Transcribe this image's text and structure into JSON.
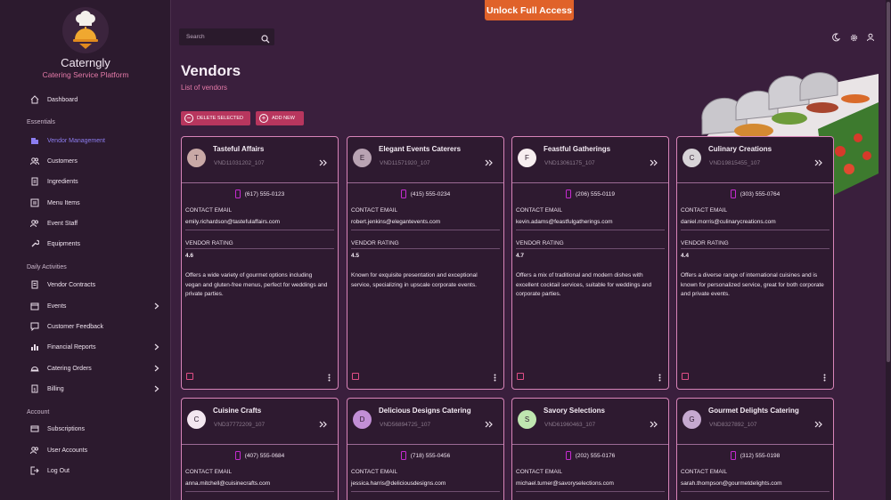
{
  "brand": {
    "name": "Caterngly",
    "tagline": "Catering Service Platform"
  },
  "sidebar": {
    "items": [
      {
        "label": "Dashboard",
        "icon": "home-icon"
      },
      {
        "section": "Essentials"
      },
      {
        "label": "Vendor Management",
        "icon": "building-icon",
        "active": true
      },
      {
        "label": "Customers",
        "icon": "users-icon"
      },
      {
        "label": "Ingredients",
        "icon": "clipboard-icon"
      },
      {
        "label": "Menu Items",
        "icon": "menu-icon"
      },
      {
        "label": "Event Staff",
        "icon": "users-icon"
      },
      {
        "label": "Equipments",
        "icon": "wrench-icon"
      },
      {
        "section": "Daily Activities"
      },
      {
        "label": "Vendor Contracts",
        "icon": "document-icon"
      },
      {
        "label": "Events",
        "icon": "calendar-icon",
        "expandable": true
      },
      {
        "label": "Customer Feedback",
        "icon": "feedback-icon"
      },
      {
        "label": "Financial Reports",
        "icon": "bar-chart-icon",
        "expandable": true
      },
      {
        "label": "Catering Orders",
        "icon": "cloche-icon",
        "expandable": true
      },
      {
        "label": "Billing",
        "icon": "invoice-icon",
        "expandable": true
      },
      {
        "section": "Account"
      },
      {
        "label": "Subscriptions",
        "icon": "subscription-icon"
      },
      {
        "label": "User Accounts",
        "icon": "users-icon"
      },
      {
        "label": "Log Out",
        "icon": "logout-icon"
      }
    ]
  },
  "header": {
    "search_placeholder": "Search",
    "unlock_label": "Unlock Full Access",
    "icons": [
      "moon-icon",
      "gear-icon",
      "user-icon"
    ]
  },
  "page": {
    "title": "Vendors",
    "subtitle": "List of vendors",
    "delete_label": "DELETE SELECTED",
    "add_label": "ADD NEW"
  },
  "labels": {
    "contact_email": "CONTACT EMAIL",
    "vendor_rating": "VENDOR RATING"
  },
  "colors": {
    "accent": "#e47aa8",
    "button": "#b8365e",
    "unlock": "#e0622a",
    "card_border": "#d784b8",
    "active_nav": "#8c7df0",
    "phone_icon": "#c52bd0"
  },
  "vendors": [
    {
      "initial": "T",
      "avatar_color": "#c9a9a6",
      "name": "Tasteful Affairs",
      "code": "VND11031202_107",
      "phone": "(617) 555-0123",
      "email": "emily.richardson@tastefulaffairs.com",
      "rating": "4.6",
      "description": "Offers a wide variety of gourmet options including vegan and gluten-free menus, perfect for weddings and private parties."
    },
    {
      "initial": "E",
      "avatar_color": "#b9a3b3",
      "name": "Elegant Events Caterers",
      "code": "VND11571920_107",
      "phone": "(415) 555-0234",
      "email": "robert.jenkins@elegantevents.com",
      "rating": "4.5",
      "description": "Known for exquisite presentation and exceptional service, specializing in upscale corporate events."
    },
    {
      "initial": "F",
      "avatar_color": "#f7eef0",
      "name": "Feastful Gatherings",
      "code": "VND13061175_107",
      "phone": "(206) 555-0119",
      "email": "kevin.adams@feastfulgatherings.com",
      "rating": "4.7",
      "description": "Offers a mix of traditional and modern dishes with excellent cocktail services, suitable for weddings and corporate parties."
    },
    {
      "initial": "C",
      "avatar_color": "#d8d4d8",
      "name": "Culinary Creations",
      "code": "VND19815455_107",
      "phone": "(303) 555-0764",
      "email": "daniel.morris@culinarycreations.com",
      "rating": "4.4",
      "description": "Offers a diverse range of international cuisines and is known for personalized service, great for both corporate and private events."
    },
    {
      "initial": "C",
      "avatar_color": "#f3e7f0",
      "name": "Cuisine Crafts",
      "code": "VND37772209_107",
      "phone": "(407) 555-0684",
      "email": "anna.mitchell@cuisinecrafts.com",
      "rating": "",
      "description": ""
    },
    {
      "initial": "D",
      "avatar_color": "#c28fd6",
      "name": "Delicious Designs Catering",
      "code": "VND56894725_107",
      "phone": "(718) 555-0456",
      "email": "jessica.harris@deliciousdesigns.com",
      "rating": "",
      "description": ""
    },
    {
      "initial": "S",
      "avatar_color": "#bfe6b0",
      "name": "Savory Selections",
      "code": "VND61960463_107",
      "phone": "(202) 555-0176",
      "email": "michael.turner@savoryselections.com",
      "rating": "",
      "description": ""
    },
    {
      "initial": "G",
      "avatar_color": "#c6a9d0",
      "name": "Gourmet Delights Catering",
      "code": "VND8327892_107",
      "phone": "(312) 555-0198",
      "email": "sarah.thompson@gourmetdelights.com",
      "rating": "",
      "description": ""
    }
  ]
}
